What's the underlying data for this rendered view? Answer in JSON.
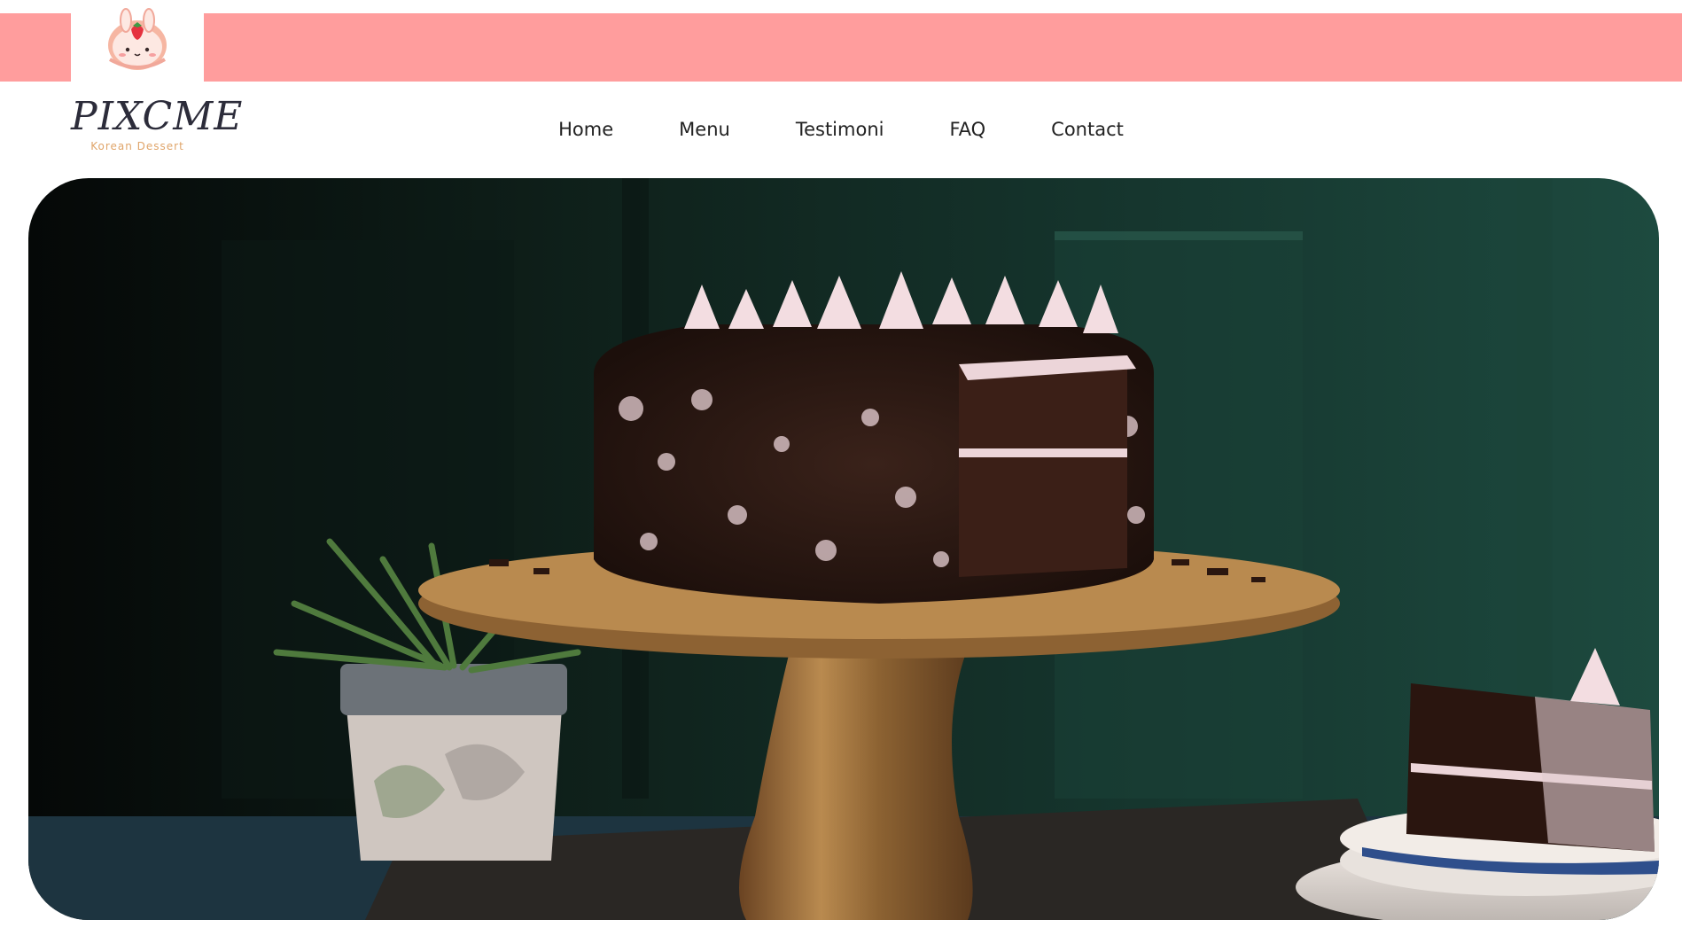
{
  "colors": {
    "accent": "#ff9d9d",
    "nav_text": "#222222",
    "brand_text": "#2c2c3a",
    "brand_sub": "#e0a56a"
  },
  "header": {
    "logo_icon": "bunny-strawberry-icon",
    "brand_name": "PIXCME",
    "brand_tagline": "Korean Dessert"
  },
  "nav": {
    "items": [
      {
        "label": "Home"
      },
      {
        "label": "Menu"
      },
      {
        "label": "Testimoni"
      },
      {
        "label": "FAQ"
      },
      {
        "label": "Contact"
      }
    ]
  },
  "hero": {
    "image": "chocolate-cake-on-wooden-stand"
  }
}
